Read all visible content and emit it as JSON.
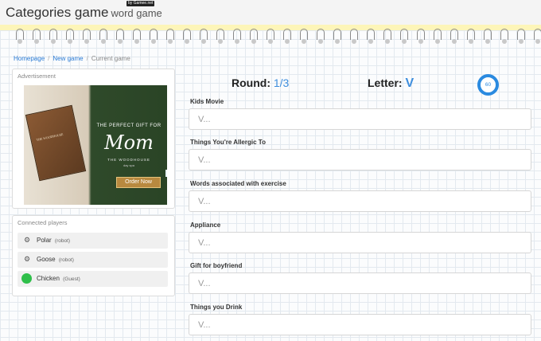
{
  "header": {
    "title": "Categories game",
    "subtitle": "word game",
    "by_badge": "by Gamee.net"
  },
  "breadcrumb": {
    "home": "Homepage",
    "new_game": "New game",
    "current": "Current game"
  },
  "ad": {
    "label": "Advertisement",
    "book_label": "THE WOODHOUSE",
    "tagline": "THE PERFECT GIFT FOR",
    "headline": "Mom",
    "brand": "THE WOODHOUSE",
    "brand_sub": "day spa",
    "cta": "Order Now",
    "adchoices": "D▷"
  },
  "players": {
    "title": "Connected players",
    "list": [
      {
        "name": "Polar",
        "tag": "(robot)",
        "icon": "robot-icon"
      },
      {
        "name": "Goose",
        "tag": "(robot)",
        "icon": "robot-icon"
      },
      {
        "name": "Chicken",
        "tag": "(Guest)",
        "icon": "green-dot"
      }
    ]
  },
  "game": {
    "round_label": "Round:",
    "round_value": "1/3",
    "letter_label": "Letter:",
    "letter_value": "V",
    "timer": "60"
  },
  "categories": [
    {
      "label": "Kids Movie",
      "placeholder": "V..."
    },
    {
      "label": "Things You're Allergic To",
      "placeholder": "V..."
    },
    {
      "label": "Words associated with exercise",
      "placeholder": "V..."
    },
    {
      "label": "Appliance",
      "placeholder": "V..."
    },
    {
      "label": "Gift for boyfriend",
      "placeholder": "V..."
    },
    {
      "label": "Things you Drink",
      "placeholder": "V..."
    }
  ],
  "colors": {
    "accent": "#3e8edd",
    "timer": "#2a8ae0",
    "link": "#2a7bd5",
    "guest_dot": "#2fbf4a",
    "banner": "#fdf5b8"
  }
}
